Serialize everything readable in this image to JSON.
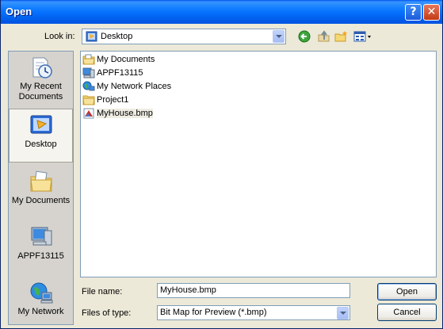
{
  "window": {
    "title": "Open"
  },
  "titlebar": {
    "help_symbol": "?",
    "close_symbol": "✕"
  },
  "lookin": {
    "label": "Look in:",
    "value": "Desktop"
  },
  "toolbar": [
    "back-icon",
    "up-folder-icon",
    "new-folder-icon",
    "views-menu-icon"
  ],
  "places": [
    {
      "label": "My Recent Documents",
      "icon": "recent-documents-icon"
    },
    {
      "label": "Desktop",
      "icon": "desktop-icon",
      "selected": true
    },
    {
      "label": "My Documents",
      "icon": "my-documents-icon"
    },
    {
      "label": "APPF13115",
      "icon": "computer-icon"
    },
    {
      "label": "My Network",
      "icon": "network-icon"
    }
  ],
  "files": [
    {
      "name": "My Documents",
      "icon": "folder-docs-icon"
    },
    {
      "name": "APPF13115",
      "icon": "computer-icon"
    },
    {
      "name": "My Network Places",
      "icon": "network-icon"
    },
    {
      "name": "Project1",
      "icon": "folder-icon"
    },
    {
      "name": "MyHouse.bmp",
      "icon": "bitmap-file-icon"
    }
  ],
  "filename": {
    "label": "File name:",
    "value": "MyHouse.bmp"
  },
  "filetype": {
    "label": "Files of type:",
    "value": "Bit Map for Preview (*.bmp)"
  },
  "buttons": {
    "open": "Open",
    "cancel": "Cancel"
  },
  "colors": {
    "titlebar": "#0054E3",
    "dialog_bg": "#ECE9D8",
    "places_bg": "#D6D3CE",
    "border": "#7F9DB9"
  }
}
